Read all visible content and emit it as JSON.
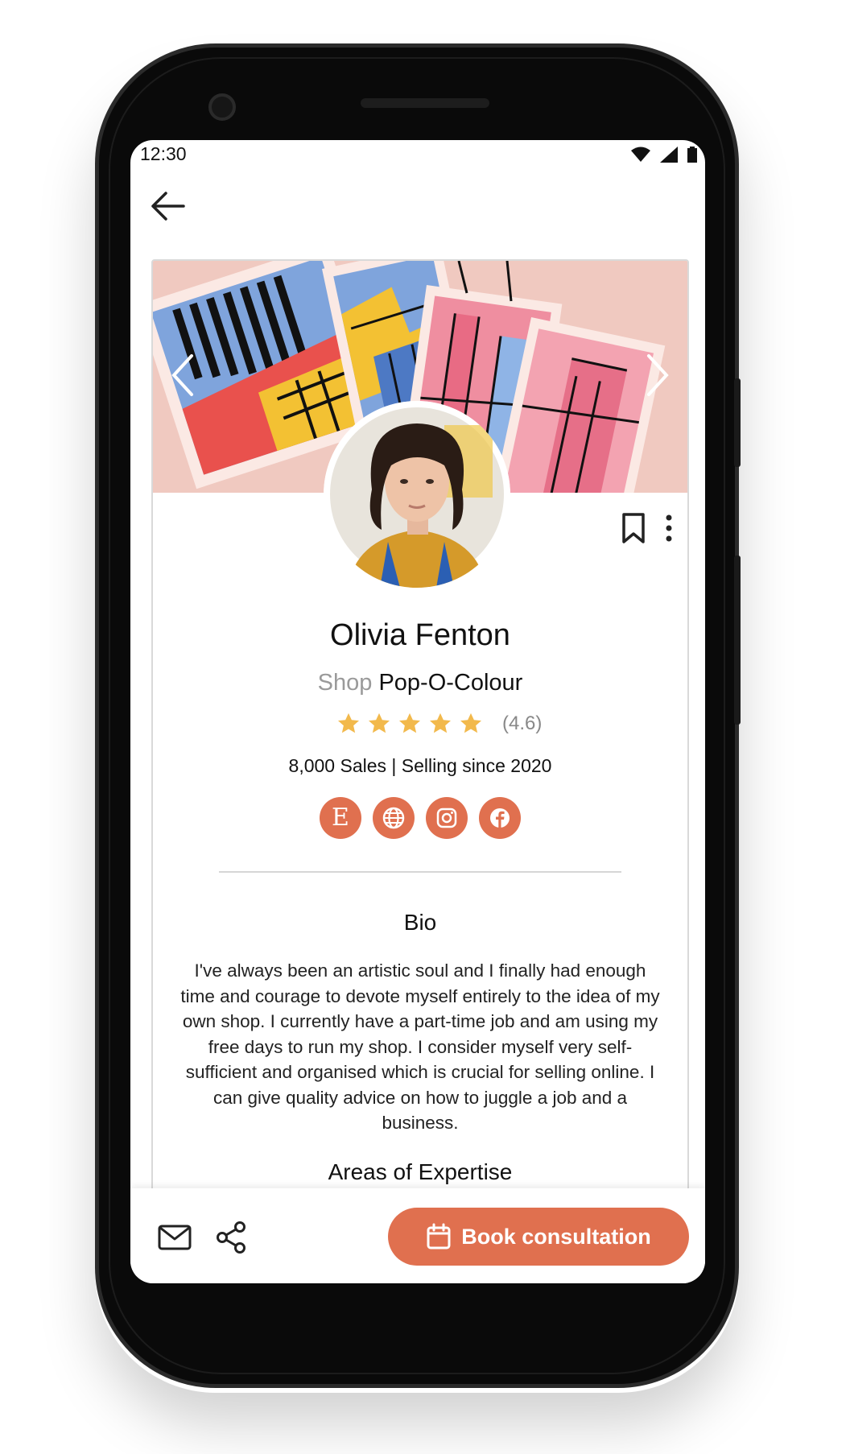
{
  "status_bar": {
    "time": "12:30"
  },
  "profile": {
    "name": "Olivia Fenton",
    "shop_prefix": "Shop",
    "shop_name": "Pop-O-Colour",
    "rating_value": 4.6,
    "rating_label": "(4.6)",
    "stars_filled": 5,
    "stats": "8,000 Sales  |  Selling since 2020"
  },
  "socials": [
    {
      "name": "etsy",
      "glyph": "E"
    },
    {
      "name": "website",
      "glyph": "globe-icon"
    },
    {
      "name": "instagram",
      "glyph": "instagram-icon"
    },
    {
      "name": "facebook",
      "glyph": "facebook-icon"
    }
  ],
  "bio": {
    "title": "Bio",
    "text": "I've always been an artistic soul and I finally had enough time and courage to devote myself entirely to the idea of my own shop. I currently have a part-time job and am using my free days to run my shop. I consider myself very self-sufficient and organised which is crucial for selling online. I can give quality advice on how to juggle a job and a business."
  },
  "next_section_title": "Areas of Expertise",
  "bottom_bar": {
    "book_label": "Book consultation"
  },
  "colors": {
    "accent": "#e0704f",
    "star": "#f2b94c",
    "muted": "#9a9a9a"
  }
}
